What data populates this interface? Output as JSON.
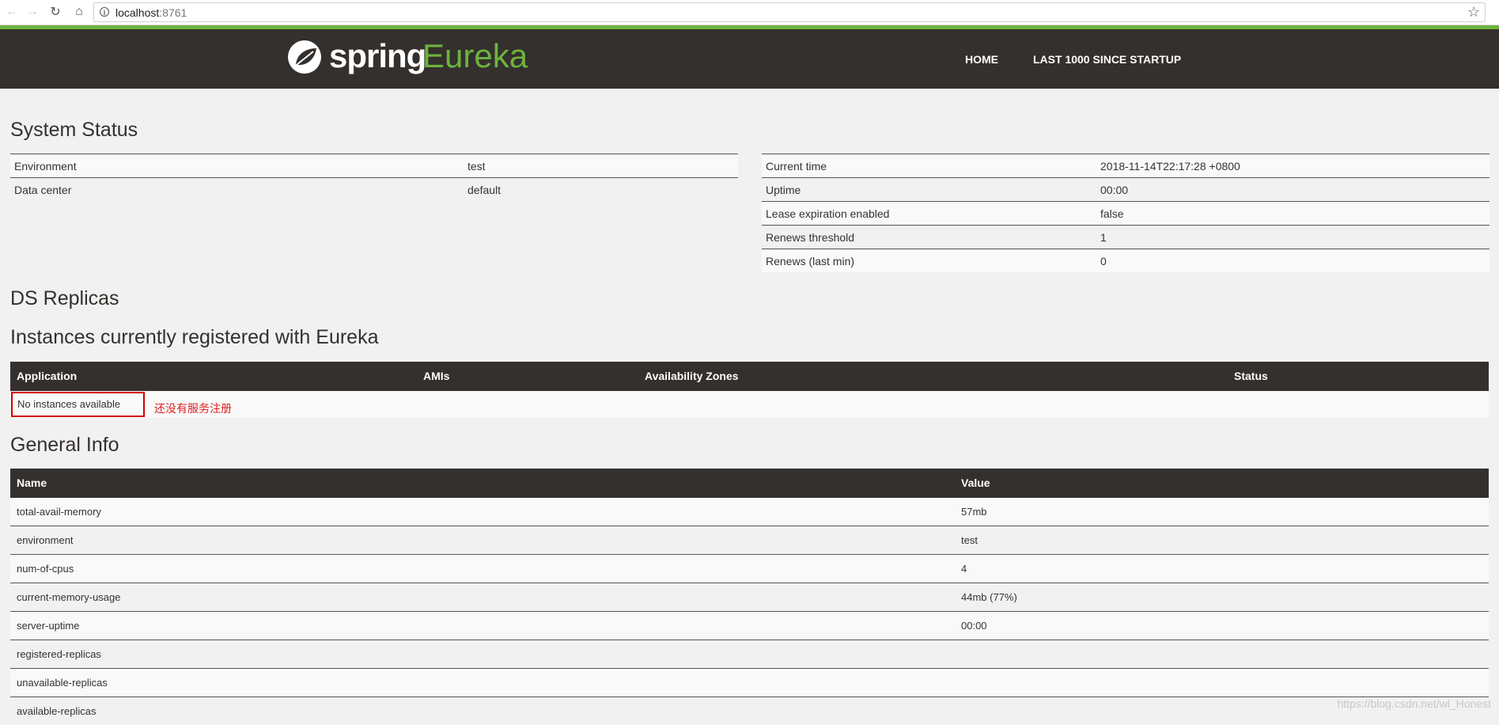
{
  "browser": {
    "url_host": "localhost",
    "url_port": ":8761"
  },
  "header": {
    "logo_spring": "spring",
    "logo_eureka": "Eureka",
    "nav": [
      "HOME",
      "LAST 1000 SINCE STARTUP"
    ]
  },
  "system_status": {
    "title": "System Status",
    "left": [
      {
        "key": "Environment",
        "value": "test"
      },
      {
        "key": "Data center",
        "value": "default"
      }
    ],
    "right": [
      {
        "key": "Current time",
        "value": "2018-11-14T22:17:28 +0800"
      },
      {
        "key": "Uptime",
        "value": "00:00"
      },
      {
        "key": "Lease expiration enabled",
        "value": "false"
      },
      {
        "key": "Renews threshold",
        "value": "1"
      },
      {
        "key": "Renews (last min)",
        "value": "0"
      }
    ]
  },
  "ds_replicas": {
    "title": "DS Replicas"
  },
  "instances": {
    "title": "Instances currently registered with Eureka",
    "columns": [
      "Application",
      "AMIs",
      "Availability Zones",
      "Status"
    ],
    "empty_text": "No instances available",
    "note": "还没有服务注册"
  },
  "general_info": {
    "title": "General Info",
    "columns": [
      "Name",
      "Value"
    ],
    "rows": [
      {
        "name": "total-avail-memory",
        "value": "57mb"
      },
      {
        "name": "environment",
        "value": "test"
      },
      {
        "name": "num-of-cpus",
        "value": "4"
      },
      {
        "name": "current-memory-usage",
        "value": "44mb (77%)"
      },
      {
        "name": "server-uptime",
        "value": "00:00"
      },
      {
        "name": "registered-replicas",
        "value": ""
      },
      {
        "name": "unavailable-replicas",
        "value": ""
      },
      {
        "name": "available-replicas",
        "value": ""
      }
    ]
  },
  "watermark": "https://blog.csdn.net/wl_Honest",
  "colors": {
    "header_bg": "#34302d",
    "accent_green": "#6db33f",
    "annotation_red": "#e02020"
  }
}
